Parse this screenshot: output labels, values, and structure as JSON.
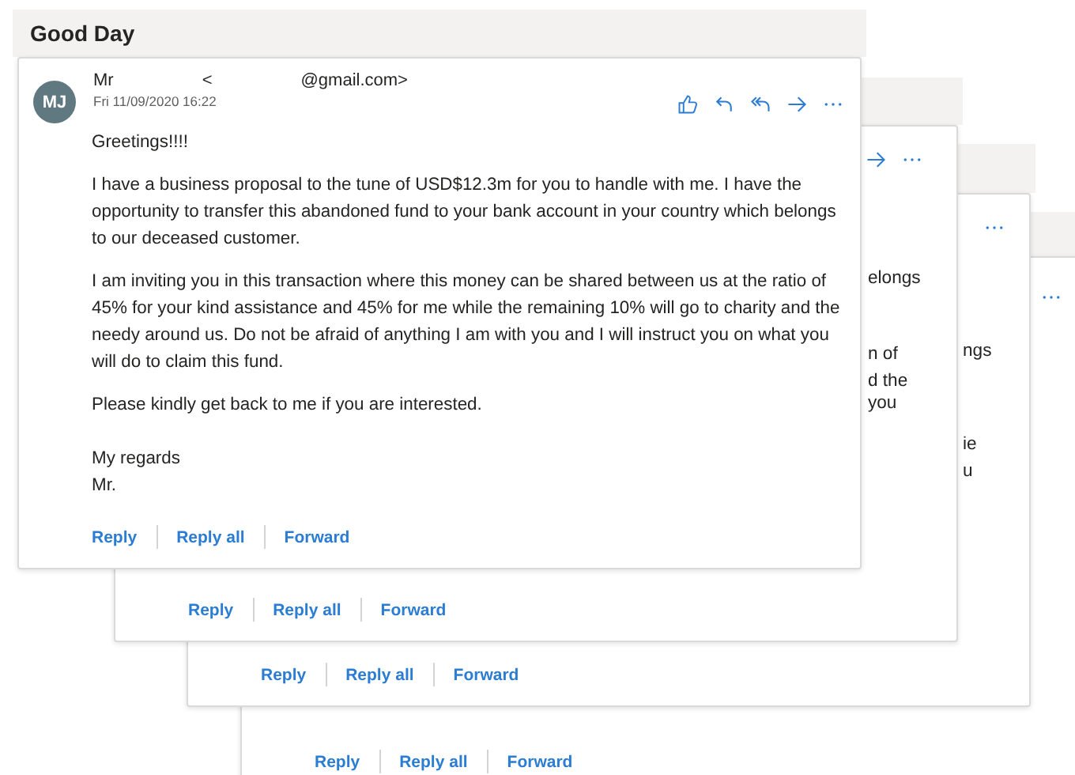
{
  "subject": "Good Day",
  "messages": [
    {
      "kind": "open",
      "avatar": "MJ",
      "sender": "Mr",
      "address_start": "<",
      "address_end": "@gmail.com>",
      "date": "Fri 11/09/2020 16:22",
      "body": [
        "Greetings!!!!",
        "I have a business proposal to the tune of USD$12.3m for you to handle with me. I have the opportunity to transfer this abandoned fund to your bank account in your country which belongs to our deceased customer.",
        "I am inviting you in this transaction where this money can be shared between us at the ratio of 45% for your kind assistance and 45% for me while the remaining 10% will go to charity and the needy around us. Do not be afraid of anything I am with you and I will instruct you on what you will do to claim this fund.",
        "Please kindly get back to me if you are interested."
      ],
      "signoff": [
        "My regards",
        "Mr."
      ],
      "actions": [
        "Reply",
        "Reply all",
        "Forward"
      ]
    },
    {
      "kind": "stacked",
      "fragments": [
        "elongs",
        "n of",
        "d the",
        "you"
      ],
      "actions": [
        "Reply",
        "Reply all",
        "Forward"
      ]
    },
    {
      "kind": "stacked",
      "fragments": [
        "ngs",
        "ie",
        "u"
      ],
      "actions": [
        "Reply",
        "Reply all",
        "Forward"
      ]
    },
    {
      "kind": "stacked",
      "actions": [
        "Reply",
        "Reply all",
        "Forward"
      ]
    }
  ]
}
